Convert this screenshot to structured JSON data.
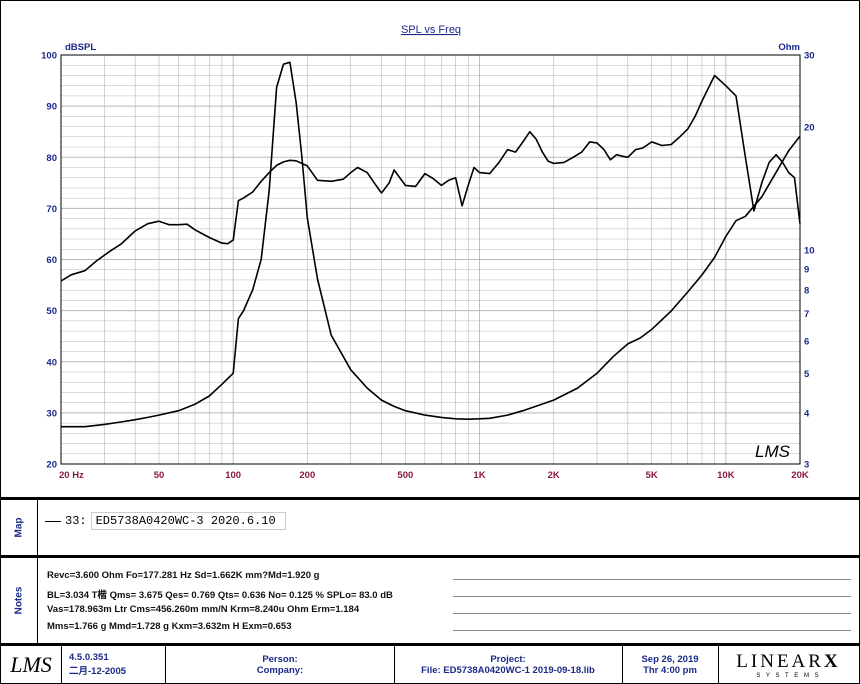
{
  "chart_data": {
    "type": "line",
    "title": "SPL vs Freq",
    "ylabel_left": "dBSPL",
    "ylabel_right": "Ohm",
    "x_scale": "log",
    "xlim": [
      20,
      20000
    ],
    "ylim_left": [
      20,
      100
    ],
    "ylim_right": [
      3,
      30
    ],
    "y_scale_right": "log",
    "x_tick_labels": [
      "20 Hz",
      "50",
      "100",
      "200",
      "500",
      "1K",
      "2K",
      "5K",
      "10K",
      "20K"
    ],
    "left_tick_labels": [
      "100",
      "90",
      "80",
      "70",
      "60",
      "50",
      "40",
      "30",
      "20"
    ],
    "right_tick_labels": [
      "30",
      "20",
      "10",
      "9",
      "8",
      "7",
      "6",
      "5",
      "4",
      "3"
    ],
    "grid": true,
    "watermark": "LMS",
    "series": [
      {
        "axis": "left",
        "x": [
          20,
          22,
          25,
          28,
          32,
          35,
          40,
          45,
          50,
          55,
          60,
          65,
          70,
          80,
          90,
          95,
          100,
          105,
          110,
          120,
          130,
          140,
          150,
          160,
          170,
          180,
          190,
          200,
          220,
          250,
          280,
          300,
          320,
          350,
          380,
          400,
          430,
          450,
          500,
          550,
          600,
          650,
          700,
          750,
          800,
          850,
          900,
          950,
          1000,
          1100,
          1200,
          1300,
          1400,
          1500,
          1600,
          1700,
          1800,
          1900,
          2000,
          2200,
          2400,
          2600,
          2800,
          3000,
          3200,
          3400,
          3600,
          3800,
          4000,
          4300,
          4600,
          5000,
          5500,
          6000,
          6500,
          7000,
          7500,
          8000,
          9000,
          10000,
          11000,
          12000,
          13000,
          14000,
          15000,
          16000,
          17000,
          18000,
          19000,
          20000
        ],
        "values": [
          55.8,
          57,
          57.8,
          59.8,
          61.8,
          63,
          65.6,
          67,
          67.5,
          66.8,
          66.8,
          66.9,
          65.8,
          64.3,
          63.2,
          63.1,
          63.8,
          71.5,
          72,
          73.2,
          75.3,
          77,
          78.4,
          79.1,
          79.4,
          79.3,
          78.8,
          78.3,
          75.5,
          75.3,
          75.7,
          77,
          78,
          77,
          74.5,
          73,
          75,
          77.5,
          74.5,
          74.3,
          76.8,
          75.8,
          74.5,
          75.5,
          76,
          70.5,
          74.5,
          78,
          77,
          76.8,
          79,
          81.5,
          81,
          83,
          85,
          83.5,
          81,
          79.2,
          78.8,
          79,
          80,
          81,
          83,
          82.8,
          81.5,
          79.5,
          80.5,
          80.2,
          80,
          81.5,
          81.8,
          83,
          82.3,
          82.5,
          84,
          85.5,
          88,
          91,
          96,
          94,
          92,
          80,
          69.5,
          75,
          79,
          80.5,
          79,
          77,
          76,
          67
        ]
      },
      {
        "axis": "right",
        "x": [
          20,
          25,
          30,
          35,
          40,
          45,
          50,
          60,
          70,
          80,
          90,
          100,
          105,
          110,
          120,
          130,
          140,
          150,
          160,
          170,
          180,
          190,
          200,
          220,
          250,
          300,
          350,
          400,
          450,
          500,
          600,
          700,
          800,
          900,
          1000,
          1100,
          1300,
          1500,
          2000,
          2500,
          3000,
          3500,
          4000,
          4500,
          5000,
          6000,
          7000,
          8000,
          9000,
          10000,
          11000,
          12000,
          14000,
          16000,
          18000,
          20000
        ],
        "values": [
          3.7,
          3.7,
          3.75,
          3.8,
          3.85,
          3.9,
          3.95,
          4.05,
          4.2,
          4.4,
          4.7,
          5,
          6.8,
          7.1,
          8,
          9.5,
          14,
          25,
          28.5,
          28.8,
          23,
          17,
          12,
          8.5,
          6.2,
          5.1,
          4.6,
          4.3,
          4.15,
          4.05,
          3.95,
          3.9,
          3.87,
          3.86,
          3.87,
          3.88,
          3.95,
          4.05,
          4.3,
          4.6,
          5,
          5.5,
          5.9,
          6.1,
          6.4,
          7.1,
          7.9,
          8.7,
          9.6,
          10.8,
          11.8,
          12.1,
          13.5,
          15.5,
          17.5,
          19
        ]
      }
    ]
  },
  "map": {
    "label": "Map",
    "entry_index": "33:",
    "entry_name": "ED5738A0420WC-3 2020.6.10"
  },
  "notes": {
    "label": "Notes",
    "lines": [
      "Revc=3.600 Ohm  Fo=177.281 Hz  Sd=1.662K mm?Md=1.920 g",
      "BL=3.034 T楷  Qms= 3.675  Qes= 0.769  Qts= 0.636  No= 0.125 %  SPLo= 83.0 dB",
      "Vas=178.963m Ltr  Cms=456.260m mm/N  Krm=8.240u Ohm  Erm=1.184",
      "Mms=1.766 g  Mmd=1.728 g  Kxm=3.632m H  Exm=0.653"
    ]
  },
  "footer": {
    "logo": "LMS",
    "version": "4.5.0.351",
    "version_date": "二月-12-2005",
    "person_label": "Person:",
    "company_label": "Company:",
    "project_label": "Project:",
    "file_text": "File: ED5738A0420WC-1 2019-09-18.lib",
    "date": "Sep 26, 2019",
    "time": "Thr  4:00 pm",
    "brand": "LINEAR",
    "brand_x": "X",
    "brand_sub": "S Y S T E M S"
  },
  "colors": {
    "axis_label": "#1b2a8a",
    "tick_x": "#8b1a3a",
    "grid": "#b8b8b8",
    "curve": "#000000"
  }
}
